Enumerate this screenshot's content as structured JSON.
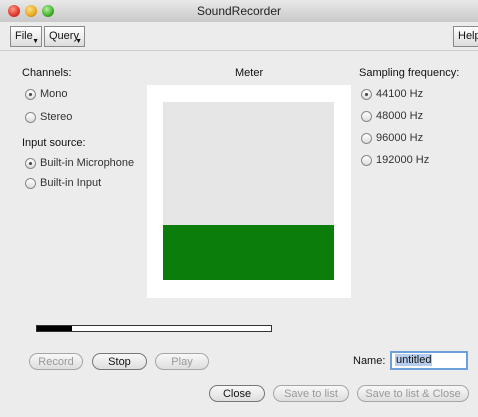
{
  "window": {
    "title": "SoundRecorder"
  },
  "menubar": {
    "file": "File",
    "query": "Query",
    "help": "Help"
  },
  "channels": {
    "heading": "Channels:",
    "options": [
      "Mono",
      "Stereo"
    ],
    "selected": "Mono"
  },
  "input_source": {
    "heading": "Input source:",
    "options": [
      "Built-in Microphone",
      "Built-in Input"
    ],
    "selected": "Built-in Microphone"
  },
  "meter": {
    "heading": "Meter",
    "level_fraction": 0.31
  },
  "sampling": {
    "heading": "Sampling frequency:",
    "options": [
      "44100 Hz",
      "48000 Hz",
      "96000 Hz",
      "192000 Hz"
    ],
    "selected": "44100 Hz"
  },
  "progress": {
    "fraction": 0.15
  },
  "buttons": {
    "record": "Record",
    "stop": "Stop",
    "play": "Play",
    "close": "Close",
    "save_to_list": "Save to list",
    "save_to_list_close": "Save to list & Close"
  },
  "name": {
    "label": "Name:",
    "value": "untitled"
  },
  "colors": {
    "meter_level": "#0a7d0a",
    "field_focus": "#6d9fd8"
  }
}
